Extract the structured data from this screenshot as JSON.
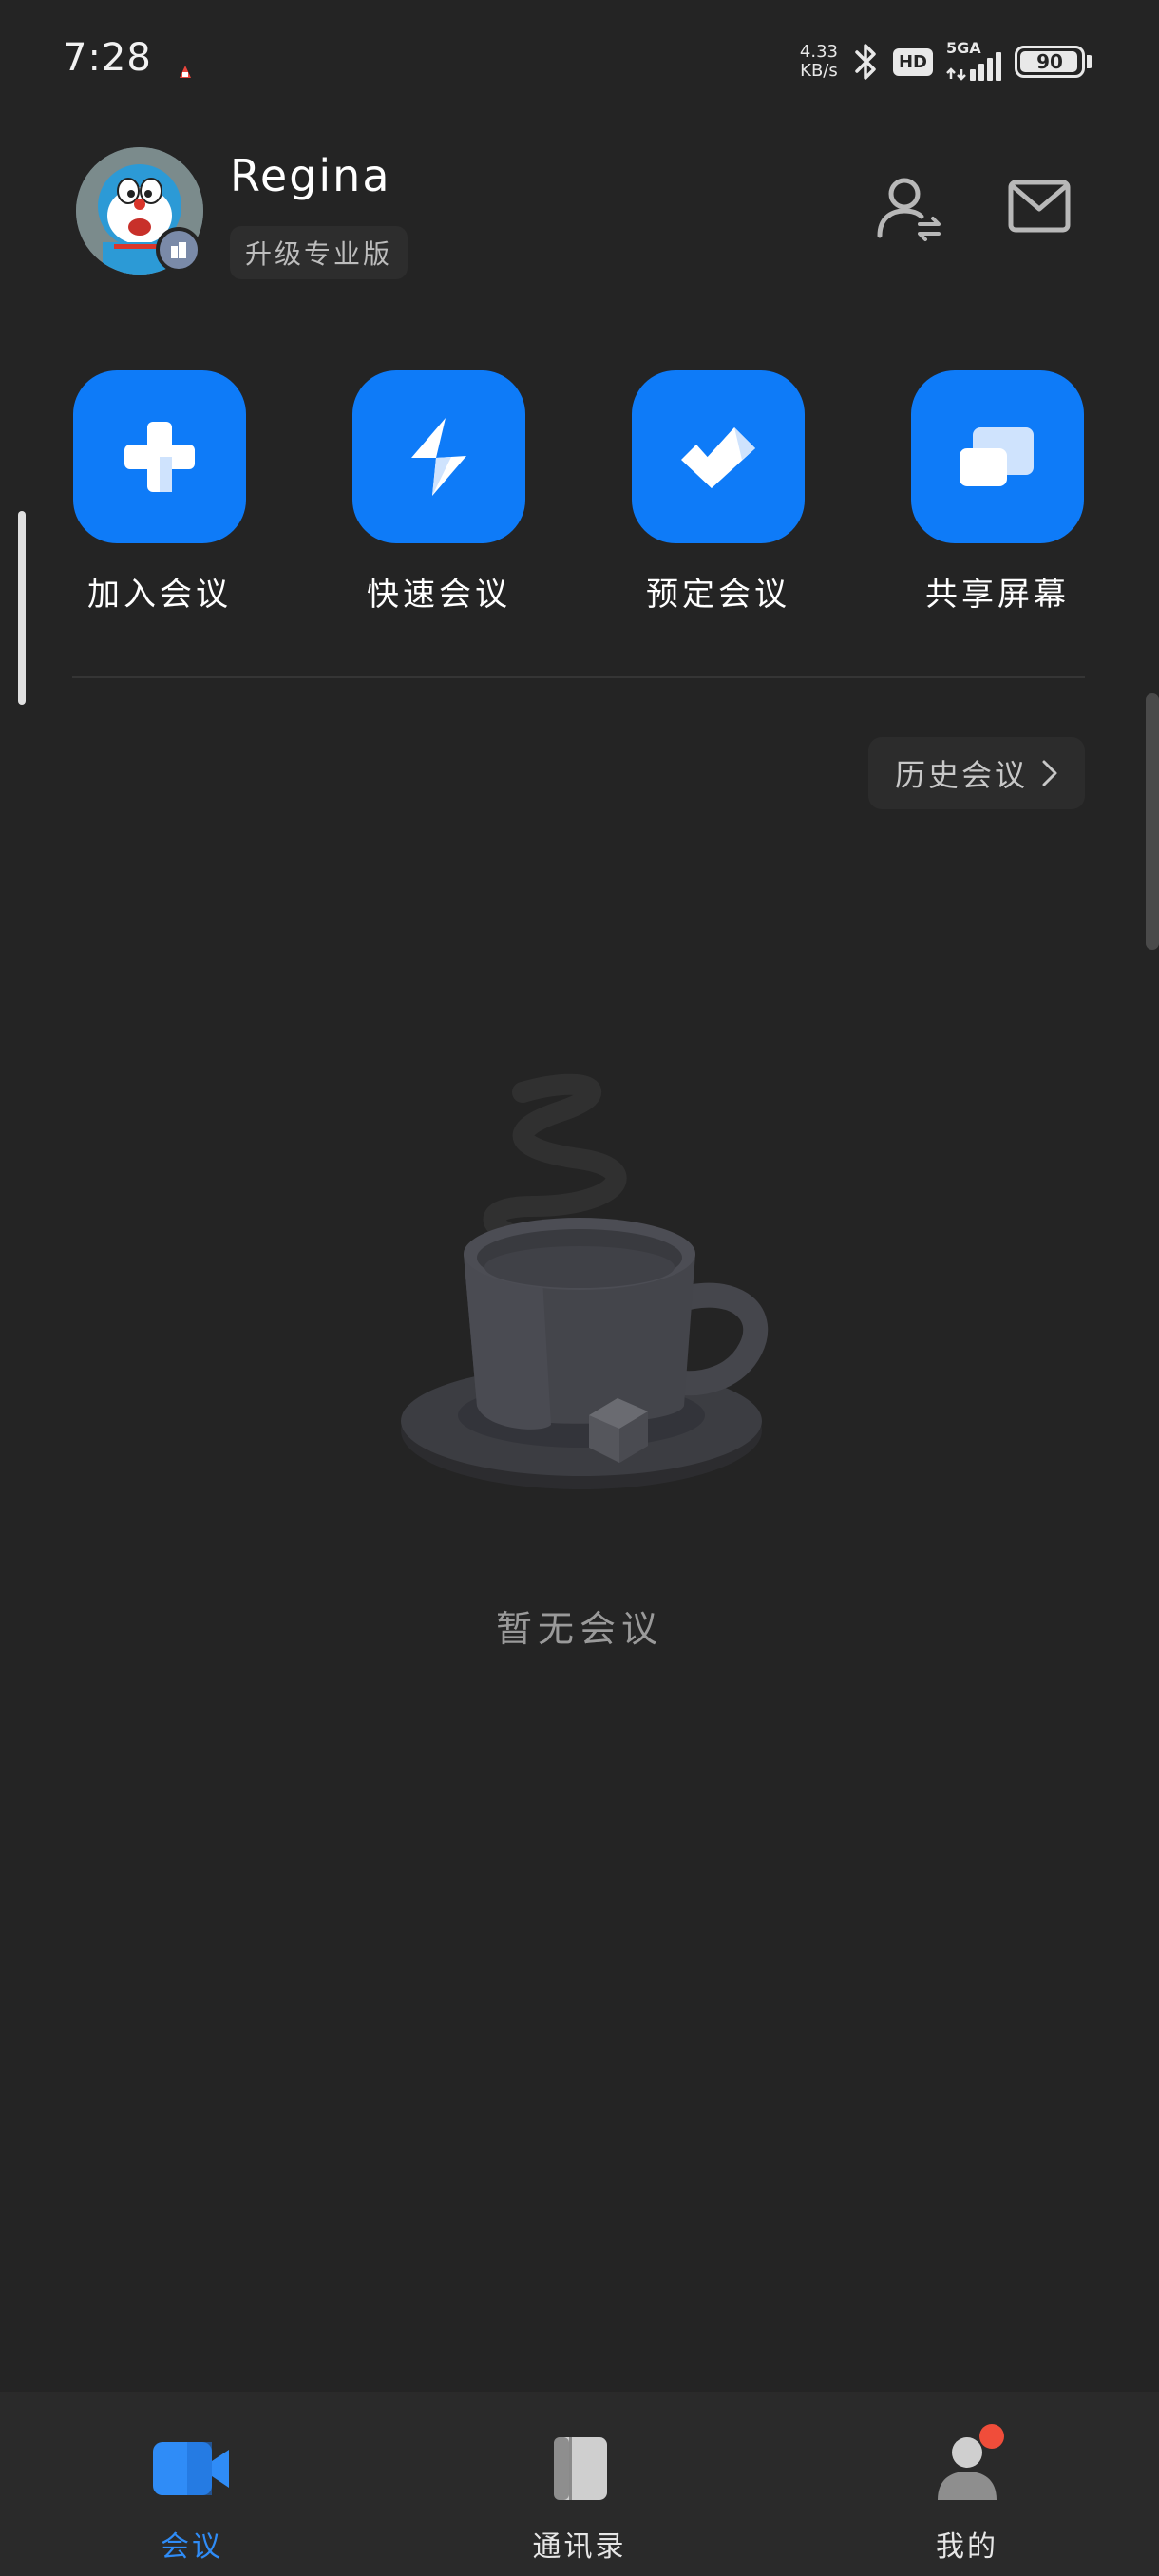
{
  "status_bar": {
    "time": "7:28",
    "net_speed_value": "4.33",
    "net_speed_unit": "KB/s",
    "hd_label": "HD",
    "network_label": "5GA",
    "battery_level": "90"
  },
  "header": {
    "user_name": "Regina",
    "upgrade_label": "升级专业版"
  },
  "quick_actions": [
    {
      "label": "加入会议",
      "icon": "plus-icon"
    },
    {
      "label": "快速会议",
      "icon": "lightning-icon"
    },
    {
      "label": "预定会议",
      "icon": "check-icon"
    },
    {
      "label": "共享屏幕",
      "icon": "screen-share-icon"
    }
  ],
  "history": {
    "label": "历史会议"
  },
  "empty_state": {
    "text": "暂无会议",
    "icon": "coffee-cup-icon"
  },
  "bottom_nav": {
    "items": [
      {
        "label": "会议",
        "icon": "video-camera-icon",
        "active": true
      },
      {
        "label": "通讯录",
        "icon": "contacts-book-icon",
        "active": false
      },
      {
        "label": "我的",
        "icon": "profile-icon",
        "active": false,
        "badge": true
      }
    ]
  },
  "colors": {
    "background": "#242424",
    "accent": "#0e7bf8",
    "nav_active": "#2f8cf7",
    "nav_inactive": "#e6e6e6",
    "badge": "#f04d3a"
  }
}
